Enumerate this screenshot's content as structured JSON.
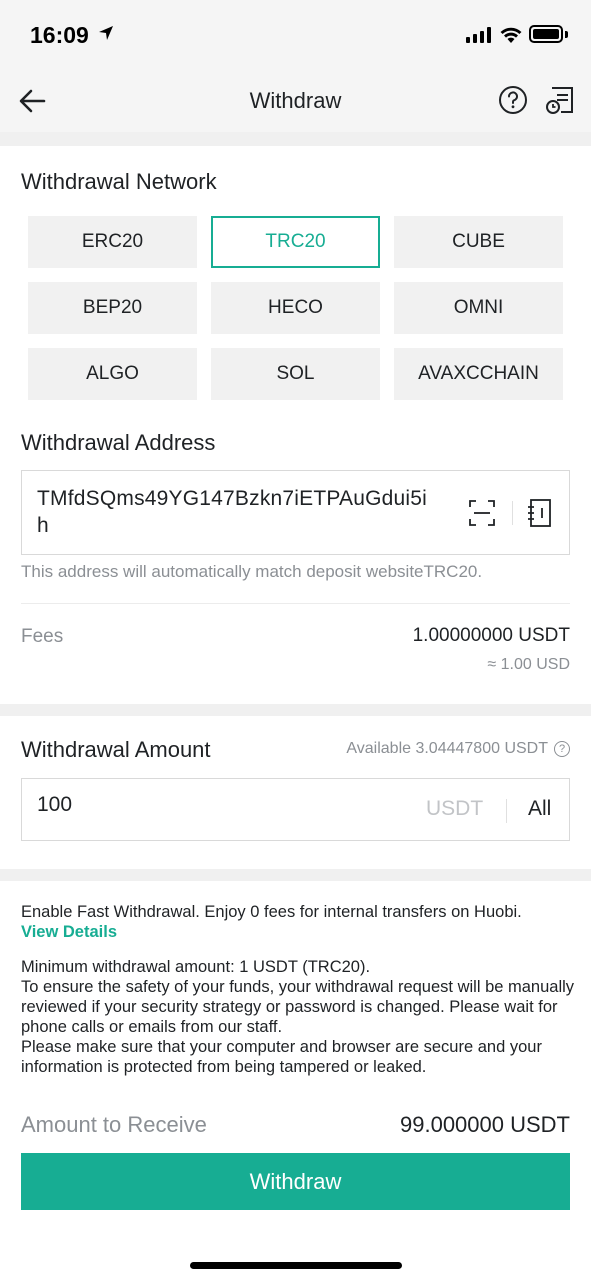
{
  "status_bar": {
    "time": "16:09"
  },
  "nav": {
    "title": "Withdraw"
  },
  "network": {
    "title": "Withdrawal Network",
    "options": [
      "ERC20",
      "TRC20",
      "CUBE",
      "BEP20",
      "HECO",
      "OMNI",
      "ALGO",
      "SOL",
      "AVAXCCHAIN"
    ],
    "selected": "TRC20"
  },
  "address": {
    "title": "Withdrawal Address",
    "value": "TMfdSQms49YG147Bzkn7iETPAuGdui5ih",
    "hint": "This address will automatically match deposit websiteTRC20."
  },
  "fees": {
    "label": "Fees",
    "value": "1.00000000 USDT",
    "approx": "≈ 1.00 USD"
  },
  "amount": {
    "title": "Withdrawal Amount",
    "available": "Available 3.04447800 USDT",
    "value": "100",
    "unit": "USDT",
    "all_label": "All"
  },
  "notes": {
    "fast": "Enable Fast Withdrawal. Enjoy 0 fees for internal transfers on Huobi.",
    "view_details": "View Details",
    "line1": "Minimum withdrawal amount: 1  USDT (TRC20).",
    "line2": "To ensure the safety of your funds, your withdrawal request will be manually reviewed if your security strategy or password is changed. Please wait for phone calls or emails from our staff.",
    "line3": "Please make sure that your computer and browser are secure and your information is protected from being tampered or leaked."
  },
  "receive": {
    "label": "Amount to Receive",
    "value": "99.000000 USDT"
  },
  "submit_label": "Withdraw",
  "colors": {
    "accent": "#17ad93",
    "muted": "#8b8f94",
    "chip": "#f1f1f1"
  }
}
